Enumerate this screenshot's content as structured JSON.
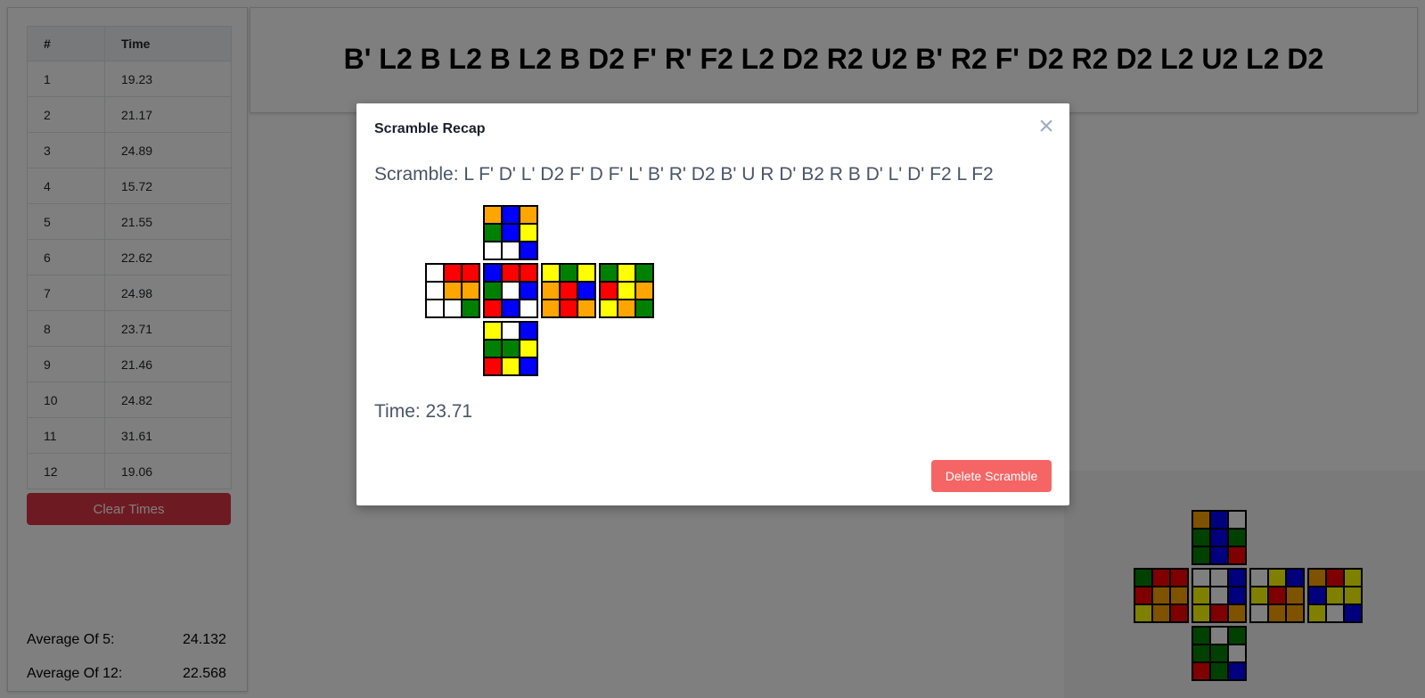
{
  "times_table": {
    "headers": [
      "#",
      "Time"
    ],
    "rows": [
      [
        "1",
        "19.23"
      ],
      [
        "2",
        "21.17"
      ],
      [
        "3",
        "24.89"
      ],
      [
        "4",
        "15.72"
      ],
      [
        "5",
        "21.55"
      ],
      [
        "6",
        "22.62"
      ],
      [
        "7",
        "24.98"
      ],
      [
        "8",
        "23.71"
      ],
      [
        "9",
        "21.46"
      ],
      [
        "10",
        "24.82"
      ],
      [
        "11",
        "31.61"
      ],
      [
        "12",
        "19.06"
      ]
    ]
  },
  "clear_button": "Clear Times",
  "averages": {
    "ao5_label": "Average Of 5:",
    "ao5_value": "24.132",
    "ao12_label": "Average Of 12:",
    "ao12_value": "22.568"
  },
  "current_scramble": "B' L2 B L2 B L2 B D2 F' R' F2 L2 D2 R2 U2 B' R2 F' D2 R2 D2 L2 U2 L2 D2",
  "modal": {
    "title": "Scramble Recap",
    "close_glyph": "×",
    "scramble_text": "Scramble: L F' D' L' D2 F' D F' L' B' R' D2 B' U R D' B2 R B D' L' D' F2 L F2",
    "time_text": "Time: 23.71",
    "delete_button": "Delete Scramble"
  },
  "colors": {
    "W": "#ffffff",
    "Y": "#ffff00",
    "R": "#ff0000",
    "O": "#ffa500",
    "B": "#0000ff",
    "G": "#008000"
  },
  "recap_cube": {
    "U": [
      "O",
      "B",
      "O",
      "G",
      "B",
      "Y",
      "W",
      "W",
      "B"
    ],
    "L": [
      "W",
      "R",
      "R",
      "W",
      "O",
      "O",
      "W",
      "W",
      "G"
    ],
    "F": [
      "B",
      "R",
      "R",
      "G",
      "W",
      "B",
      "R",
      "B",
      "W"
    ],
    "R": [
      "Y",
      "G",
      "Y",
      "O",
      "R",
      "B",
      "O",
      "R",
      "O"
    ],
    "B": [
      "G",
      "Y",
      "G",
      "R",
      "Y",
      "O",
      "Y",
      "O",
      "G"
    ],
    "D": [
      "Y",
      "W",
      "B",
      "G",
      "G",
      "Y",
      "R",
      "Y",
      "B"
    ]
  },
  "main_cube": {
    "U": [
      "O",
      "B",
      "W",
      "G",
      "B",
      "G",
      "G",
      "B",
      "R"
    ],
    "L": [
      "G",
      "R",
      "R",
      "R",
      "O",
      "O",
      "Y",
      "O",
      "R"
    ],
    "F": [
      "W",
      "W",
      "B",
      "Y",
      "W",
      "B",
      "Y",
      "R",
      "O"
    ],
    "R": [
      "W",
      "Y",
      "B",
      "Y",
      "R",
      "O",
      "W",
      "O",
      "O"
    ],
    "B": [
      "O",
      "R",
      "Y",
      "B",
      "Y",
      "Y",
      "Y",
      "W",
      "B"
    ],
    "D": [
      "G",
      "W",
      "G",
      "G",
      "G",
      "W",
      "R",
      "G",
      "B"
    ]
  }
}
